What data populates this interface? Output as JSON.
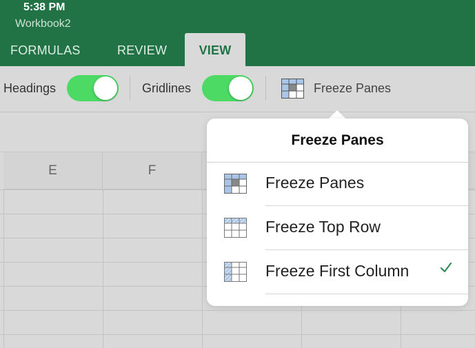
{
  "status_bar": {
    "time": "5:38 PM",
    "workbook_name": "Workbook2"
  },
  "tabs": [
    {
      "label": "FORMULAS",
      "active": false
    },
    {
      "label": "REVIEW",
      "active": false
    },
    {
      "label": "VIEW",
      "active": true
    }
  ],
  "ribbon": {
    "headings_label": "Headings",
    "headings_on": true,
    "gridlines_label": "Gridlines",
    "gridlines_on": true,
    "freeze_panes_label": "Freeze Panes",
    "freeze_panes_icon": "freeze-panes-icon"
  },
  "sheet": {
    "columns": [
      "E",
      "F"
    ]
  },
  "popover": {
    "title": "Freeze Panes",
    "items": [
      {
        "label": "Freeze Panes",
        "icon": "freeze-panes-icon",
        "checked": false
      },
      {
        "label": "Freeze Top Row",
        "icon": "freeze-top-row-icon",
        "checked": false
      },
      {
        "label": "Freeze First Column",
        "icon": "freeze-first-column-icon",
        "checked": true
      }
    ]
  },
  "colors": {
    "app_green": "#217346",
    "toggle_on": "#4cd964",
    "check_green": "#2e8b57"
  }
}
